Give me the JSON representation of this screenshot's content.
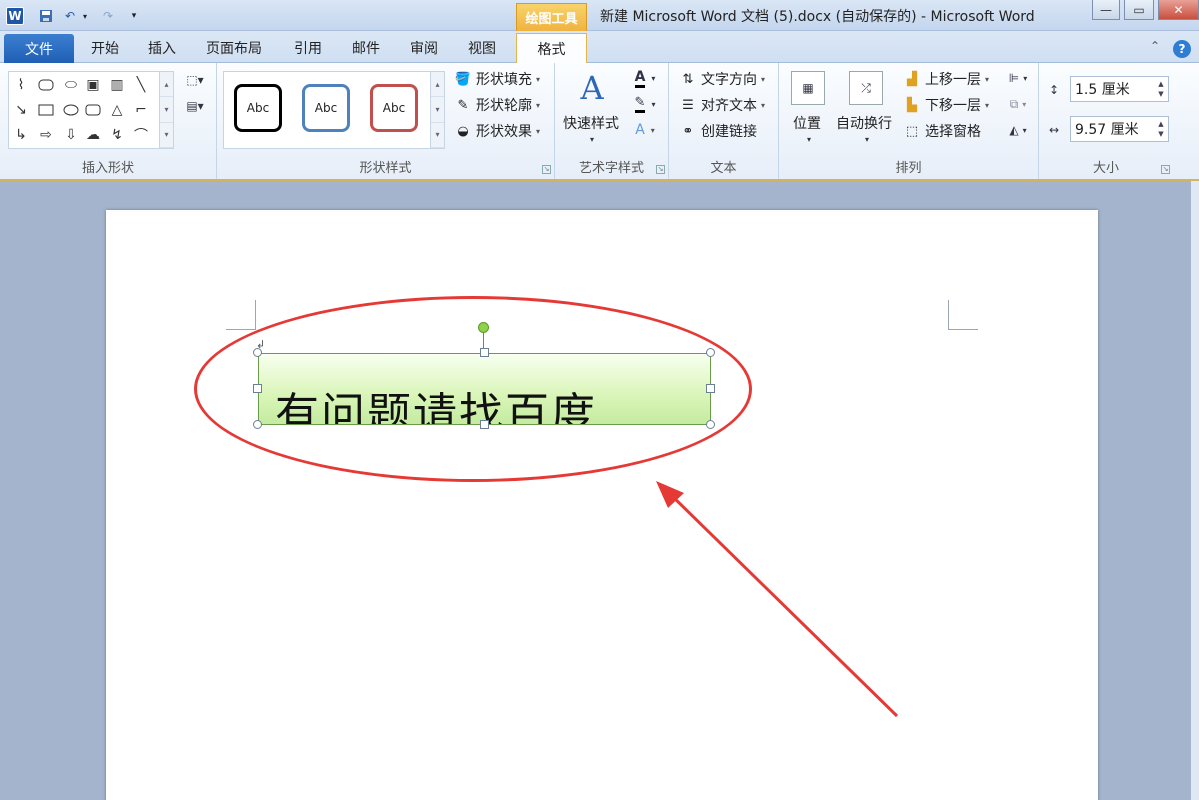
{
  "window": {
    "title": "新建 Microsoft Word 文档 (5).docx (自动保存的) - Microsoft Word",
    "contextual_tab_group": "绘图工具",
    "app_icon": "W",
    "controls": [
      "—",
      "▭",
      "✕"
    ]
  },
  "tabs": {
    "file": "文件",
    "items": [
      "开始",
      "插入",
      "页面布局",
      "引用",
      "邮件",
      "审阅",
      "视图"
    ],
    "active": "格式"
  },
  "ribbon": {
    "insert_shapes": {
      "label": "插入形状"
    },
    "shape_styles": {
      "label": "形状样式",
      "gallery": [
        "Abc",
        "Abc",
        "Abc"
      ],
      "gallery_border_colors": [
        "#000000",
        "#4f81bd",
        "#c0504d"
      ],
      "fill": "形状填充",
      "outline": "形状轮廓",
      "effects": "形状效果"
    },
    "wordart": {
      "label": "艺术字样式",
      "quick_styles": "快速样式"
    },
    "text": {
      "label": "文本",
      "direction": "文字方向",
      "align": "对齐文本",
      "link": "创建链接"
    },
    "arrange": {
      "label": "排列",
      "position": "位置",
      "wrap": "自动换行",
      "bring_forward": "上移一层",
      "send_backward": "下移一层",
      "selection_pane": "选择窗格"
    },
    "size": {
      "label": "大小",
      "height": "1.5 厘米",
      "width": "9.57 厘米"
    }
  },
  "document": {
    "textbox_text": "有问题请找百度",
    "textbox_fill": "#d9f5b8",
    "annotation_color": "#e53935"
  }
}
